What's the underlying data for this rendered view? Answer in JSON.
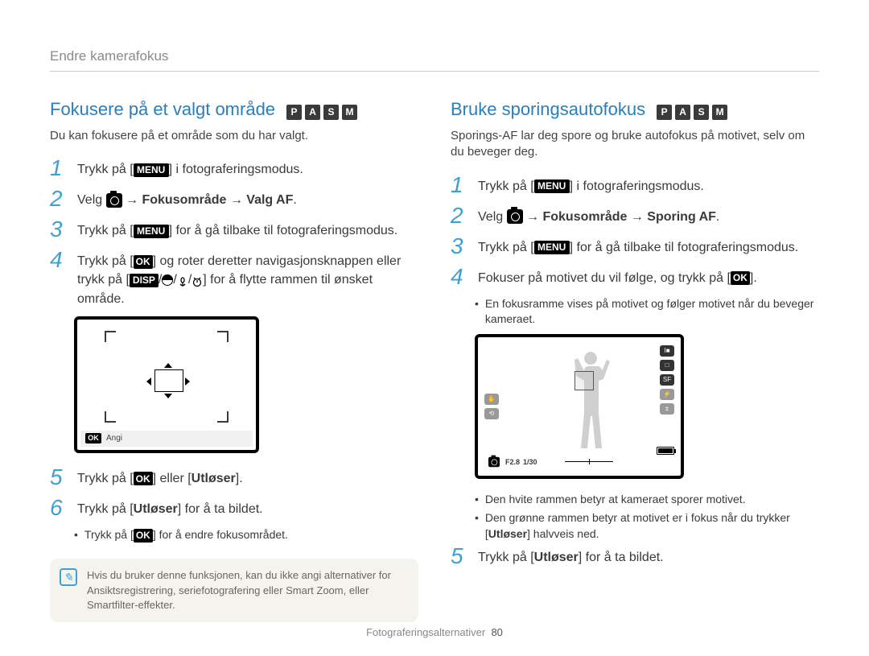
{
  "topbar": "Endre kamerafokus",
  "modes": {
    "p": "P",
    "a": "A",
    "s": "S",
    "m": "M"
  },
  "labels": {
    "menu": "MENU",
    "ok": "OK",
    "disp": "DISP",
    "angi": "Angi"
  },
  "left": {
    "heading": "Fokusere på et valgt område",
    "intro": "Du kan fokusere på et område som du har valgt.",
    "step1a": "Trykk på [",
    "step1b": "] i fotograferingsmodus.",
    "step2a": "Velg ",
    "step2b": " → Fokusområde → Valg AF",
    "step2c": ".",
    "step3a": "Trykk på [",
    "step3b": "] for å gå tilbake til fotograferingsmodus.",
    "step4a": "Trykk på [",
    "step4b": "] og roter deretter navigasjonsknappen eller trykk på [",
    "step4c": "] for å flytte rammen til ønsket område.",
    "step5a": "Trykk på [",
    "step5b": "] eller [",
    "step5c": "Utløser",
    "step5d": "].",
    "step6a": "Trykk på [",
    "step6b": "Utløser",
    "step6c": "] for å ta bildet.",
    "bulleta": "Trykk på [",
    "bulletb": "] for å endre fokusområdet.",
    "note": "Hvis du bruker denne funksjonen, kan du ikke angi alternativer for Ansiktsregistrering, seriefotografering eller Smart Zoom, eller Smartfilter-effekter."
  },
  "right": {
    "heading": "Bruke sporingsautofokus",
    "intro": "Sporings-AF lar deg spore og bruke autofokus på motivet, selv om du beveger deg.",
    "step1a": "Trykk på [",
    "step1b": "] i fotograferingsmodus.",
    "step2a": "Velg ",
    "step2b": " → Fokusområde → Sporing AF",
    "step2c": ".",
    "step3a": "Trykk på [",
    "step3b": "] for å gå tilbake til fotograferingsmodus.",
    "step4a": "Fokuser på motivet du vil følge, og trykk på [",
    "step4b": "].",
    "bullet4": "En fokusramme vises på motivet og følger motivet når du beveger kameraet.",
    "bullet5a": "Den hvite rammen betyr at kameraet sporer motivet.",
    "bullet5b_1": "Den grønne rammen betyr at motivet er i fokus når du trykker [",
    "bullet5b_2": "Utløser",
    "bullet5b_3": "] halvveis ned.",
    "step5a": "Trykk på [",
    "step5b": "Utløser",
    "step5c": "] for å ta bildet.",
    "hud": {
      "f": "F2.8",
      "s": "1/30"
    }
  },
  "footer": {
    "text": "Fotograferingsalternativer",
    "page": "80"
  }
}
